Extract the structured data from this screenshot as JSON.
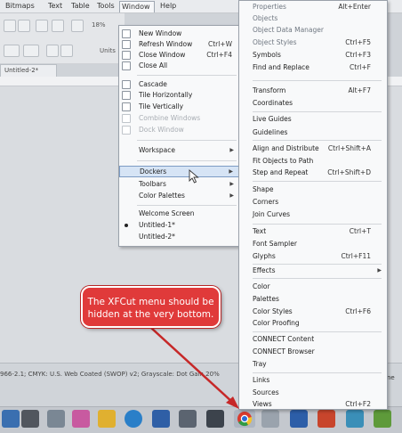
{
  "menubar": {
    "items": [
      "Bitmaps",
      "Text",
      "Table",
      "Tools",
      "Window",
      "Help"
    ]
  },
  "toolbar": {
    "zoom_value": "18%",
    "units_label": "Units"
  },
  "document_tab": "Untitled-2*",
  "status_text": "966-2.1; CMYK: U.S. Web Coated (SWOP) v2; Grayscale: Dot Gain 20%",
  "right_clip_text": "ine",
  "window_menu": {
    "items": [
      {
        "label": "New Window",
        "shortcut": ""
      },
      {
        "label": "Refresh Window",
        "shortcut": "Ctrl+W"
      },
      {
        "label": "Close Window",
        "shortcut": "Ctrl+F4"
      },
      {
        "label": "Close All",
        "shortcut": ""
      },
      {
        "label": "Cascade",
        "shortcut": ""
      },
      {
        "label": "Tile Horizontally",
        "shortcut": ""
      },
      {
        "label": "Tile Vertically",
        "shortcut": ""
      },
      {
        "label": "Combine Windows",
        "shortcut": ""
      },
      {
        "label": "Dock Window",
        "shortcut": ""
      },
      {
        "label": "Workspace",
        "shortcut": ""
      },
      {
        "label": "Dockers",
        "shortcut": ""
      },
      {
        "label": "Toolbars",
        "shortcut": ""
      },
      {
        "label": "Color Palettes",
        "shortcut": ""
      },
      {
        "label": "Welcome Screen",
        "shortcut": ""
      },
      {
        "label": "Untitled-1*",
        "shortcut": ""
      },
      {
        "label": "Untitled-2*",
        "shortcut": ""
      }
    ]
  },
  "dockers_menu": {
    "items": [
      {
        "label": "Properties",
        "shortcut": "Alt+Enter"
      },
      {
        "label": "Objects",
        "shortcut": ""
      },
      {
        "label": "Object Data Manager",
        "shortcut": ""
      },
      {
        "label": "Object Styles",
        "shortcut": "Ctrl+F5"
      },
      {
        "label": "Symbols",
        "shortcut": "Ctrl+F3"
      },
      {
        "label": "Find and Replace",
        "shortcut": "Ctrl+F"
      },
      {
        "label": "Transform",
        "shortcut": "Alt+F7"
      },
      {
        "label": "Coordinates",
        "shortcut": ""
      },
      {
        "label": "Live Guides",
        "shortcut": ""
      },
      {
        "label": "Guidelines",
        "shortcut": ""
      },
      {
        "label": "Align and Distribute",
        "shortcut": "Ctrl+Shift+A"
      },
      {
        "label": "Fit Objects to Path",
        "shortcut": ""
      },
      {
        "label": "Step and Repeat",
        "shortcut": "Ctrl+Shift+D"
      },
      {
        "label": "Shape",
        "shortcut": ""
      },
      {
        "label": "Corners",
        "shortcut": ""
      },
      {
        "label": "Join Curves",
        "shortcut": ""
      },
      {
        "label": "Text",
        "shortcut": "Ctrl+T"
      },
      {
        "label": "Font Sampler",
        "shortcut": ""
      },
      {
        "label": "Glyphs",
        "shortcut": "Ctrl+F11"
      },
      {
        "label": "Effects",
        "shortcut": ""
      },
      {
        "label": "Color",
        "shortcut": ""
      },
      {
        "label": "Palettes",
        "shortcut": ""
      },
      {
        "label": "Color Styles",
        "shortcut": "Ctrl+F6"
      },
      {
        "label": "Color Proofing",
        "shortcut": ""
      },
      {
        "label": "CONNECT Content",
        "shortcut": ""
      },
      {
        "label": "CONNECT Browser",
        "shortcut": ""
      },
      {
        "label": "Tray",
        "shortcut": ""
      },
      {
        "label": "Links",
        "shortcut": ""
      },
      {
        "label": "Sources",
        "shortcut": ""
      },
      {
        "label": "Views",
        "shortcut": "Ctrl+F2"
      }
    ]
  },
  "callout": {
    "text_line1": "The XFCut menu should be",
    "text_line2": "hidden at the very bottom."
  },
  "colors": {
    "callout_fill": "#e03a3a",
    "callout_arrow": "#c62828",
    "menu_highlight": "#d6e4f5"
  },
  "taskbar_icons": [
    "start-icon",
    "task-view-icon",
    "app-icon",
    "photos-icon",
    "file-explorer-icon",
    "edge-icon",
    "store-icon",
    "calculator-icon",
    "terminal-icon",
    "chrome-icon",
    "coreldraw-icon",
    "app-icon-2",
    "app-icon-3",
    "app-icon-4",
    "app-icon-5"
  ]
}
